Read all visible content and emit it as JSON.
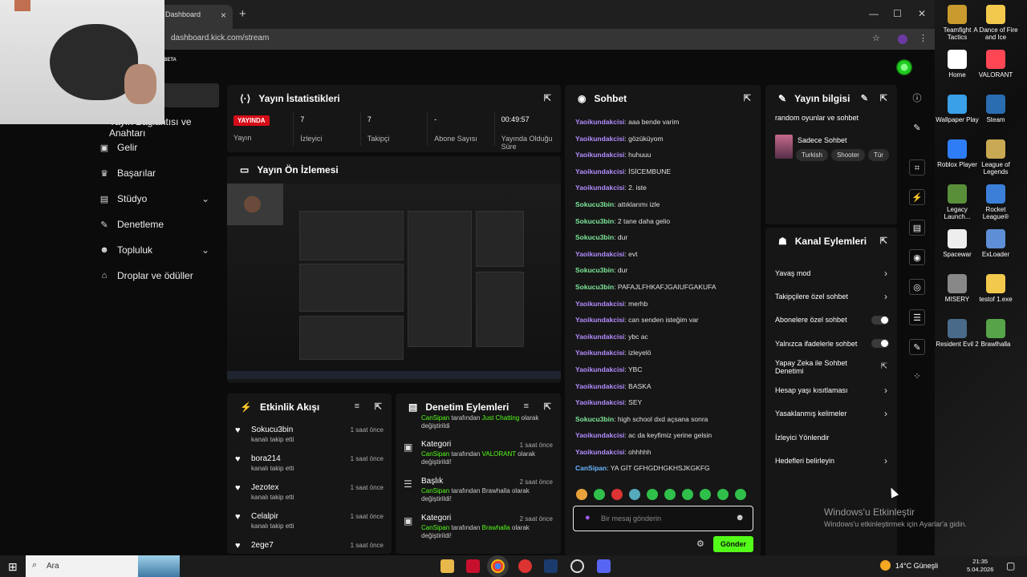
{
  "browser": {
    "tab_title": "Dashboard",
    "url": "dashboard.kick.com/stream",
    "beta_label": "BETA"
  },
  "sidebar": {
    "items": [
      {
        "label": "Yayın Bağlantısı ve Anahtarı",
        "icon": "key-icon"
      },
      {
        "label": "Gelir",
        "icon": "wallet-icon"
      },
      {
        "label": "Başarılar",
        "icon": "trophy-icon"
      },
      {
        "label": "Stüdyo",
        "icon": "studio-icon"
      },
      {
        "label": "Denetleme",
        "icon": "wrench-icon"
      },
      {
        "label": "Topluluk",
        "icon": "users-icon"
      },
      {
        "label": "Droplar ve ödüller",
        "icon": "gift-icon"
      }
    ]
  },
  "stats": {
    "title": "Yayın İstatistikleri",
    "live_badge": "YAYINDA",
    "items": [
      {
        "value": "",
        "label": "Yayın"
      },
      {
        "value": "7",
        "label": "İzleyici"
      },
      {
        "value": "7",
        "label": "Takipçi"
      },
      {
        "value": "-",
        "label": "Abone Sayısı"
      },
      {
        "value": "00:49:57",
        "label": "Yayında Olduğu Süre"
      }
    ]
  },
  "preview": {
    "title": "Yayın Ön İzlemesi"
  },
  "feed": {
    "title": "Etkinlik Akışı",
    "items": [
      {
        "name": "Sokucu3bin",
        "action": "kanalı takip etti",
        "time": "1 saat önce"
      },
      {
        "name": "bora214",
        "action": "kanalı takip etti",
        "time": "1 saat önce"
      },
      {
        "name": "Jezotex",
        "action": "kanalı takip etti",
        "time": "1 saat önce"
      },
      {
        "name": "Celalpir",
        "action": "kanalı takip etti",
        "time": "1 saat önce"
      },
      {
        "name": "2ege7",
        "action": "",
        "time": "1 saat önce"
      }
    ]
  },
  "mod": {
    "title": "Denetim Eylemleri",
    "top_partial": {
      "user": "CanSipan",
      "mid": " tarafından ",
      "value": "Just Chatting",
      "end": " olarak",
      "line2": "değiştirildi"
    },
    "items": [
      {
        "type": "Kategori",
        "time": "1 saat önce",
        "user": "CanSipan",
        "mid": " tarafından ",
        "value": "VALORANT",
        "end": " olarak",
        "line2": "değiştirildi!"
      },
      {
        "type": "Başlık",
        "time": "2 saat önce",
        "user": "CanSipan",
        "mid": " tarafından Brawhalla olarak",
        "value": "",
        "end": "",
        "line2": "değiştirildi!"
      },
      {
        "type": "Kategori",
        "time": "2 saat önce",
        "user": "CanSipan",
        "mid": " tarafından ",
        "value": "Brawhalla",
        "end": " olarak",
        "line2": "değiştirildi!"
      }
    ]
  },
  "chat": {
    "title": "Sohbet",
    "messages": [
      {
        "user": "Yaoikundakcisi",
        "text": ": aaa bende varim",
        "color": "#b48cff"
      },
      {
        "user": "Yaoikundakcisi",
        "text": ": gözüküyom",
        "color": "#b48cff"
      },
      {
        "user": "Yaoikundakcisi",
        "text": ": huhuuu",
        "color": "#b48cff"
      },
      {
        "user": "Yaoikundakcisi",
        "text": ": İSİCEMBUNE",
        "color": "#b48cff"
      },
      {
        "user": "Yaoikundakcisi",
        "text": ": 2. iste",
        "color": "#b48cff"
      },
      {
        "user": "Sokucu3bin",
        "text": ": attıklarımı izle",
        "color": "#7ee89a"
      },
      {
        "user": "Sokucu3bin",
        "text": ": 2 tane daha gelio",
        "color": "#7ee89a"
      },
      {
        "user": "Sokucu3bin",
        "text": ": dur",
        "color": "#7ee89a"
      },
      {
        "user": "Yaoikundakcisi",
        "text": ": evt",
        "color": "#b48cff"
      },
      {
        "user": "Sokucu3bin",
        "text": ": dur",
        "color": "#7ee89a"
      },
      {
        "user": "Sokucu3bin",
        "text": ": PAFAJLFHKAFJGAIUFGAKUFA",
        "color": "#7ee89a"
      },
      {
        "user": "Yaoikundakcisi",
        "text": ": merhb",
        "color": "#b48cff"
      },
      {
        "user": "Yaoikundakcisi",
        "text": ": can senden isteğim var",
        "color": "#b48cff"
      },
      {
        "user": "Yaoikundakcisi",
        "text": ": ybc ac",
        "color": "#b48cff"
      },
      {
        "user": "Yaoikundakcisi",
        "text": ": izleyelö",
        "color": "#b48cff"
      },
      {
        "user": "Yaoikundakcisi",
        "text": ": YBC",
        "color": "#b48cff"
      },
      {
        "user": "Yaoikundakcisi",
        "text": ": BASKA",
        "color": "#b48cff"
      },
      {
        "user": "Yaoikundakcisi",
        "text": ": SEY",
        "color": "#b48cff"
      },
      {
        "user": "Sokucu3bin",
        "text": ": high school dxd açsana sonra",
        "color": "#7ee89a"
      },
      {
        "user": "Yaoikundakcisi",
        "text": ": ac da keyfimiz yerine gelsin",
        "color": "#b48cff"
      },
      {
        "user": "Yaoikundakcisi",
        "text": ": ohhhhh",
        "color": "#b48cff"
      },
      {
        "user": "CanSipan",
        "text": ": YA GİT GFHGDHGKHSJKGKFG",
        "color": "#6bb7ff"
      }
    ],
    "placeholder": "Bir mesaj gönderin",
    "send_label": "Gönder"
  },
  "info": {
    "title": "Yayın bilgisi",
    "stream_title": "random oyunlar ve sohbet",
    "language_label": "Sadece Sohbet",
    "tags": [
      "Turkish",
      "Shooter",
      "Tür"
    ]
  },
  "actions": {
    "title": "Kanal Eylemleri",
    "items": [
      {
        "label": "Yavaş mod",
        "control": "arrow"
      },
      {
        "label": "Takipçilere özel sohbet",
        "control": "arrow"
      },
      {
        "label": "Abonelere özel sohbet",
        "control": "toggle"
      },
      {
        "label": "Yalnızca ifadelerle sohbet",
        "control": "toggle"
      },
      {
        "label": "Yapay Zeka ile Sohbet Denetimi",
        "control": "external"
      },
      {
        "label": "Hesap yaşı kısıtlaması",
        "control": "arrow"
      },
      {
        "label": "Yasaklanmış kelimeler",
        "control": "arrow"
      },
      {
        "label": "İzleyici Yönlendir",
        "control": "none"
      },
      {
        "label": "Hedefleri belirleyin",
        "control": "arrow"
      }
    ]
  },
  "desktop": {
    "icons": [
      {
        "label": "Teamfight Tactics",
        "color": "#c99a2e"
      },
      {
        "label": "A Dance of Fire and Ice",
        "color": "#f2c94c"
      },
      {
        "label": "Home",
        "color": "#ffffff"
      },
      {
        "label": "VALORANT",
        "color": "#ff4655"
      },
      {
        "label": "Wallpaper Play",
        "color": "#3aa0e8"
      },
      {
        "label": "Steam",
        "color": "#2a6cb0"
      },
      {
        "label": "Roblox Player",
        "color": "#2f7df6"
      },
      {
        "label": "League of Legends",
        "color": "#c8a852"
      },
      {
        "label": "Legacy Launch...",
        "color": "#5a8f3a"
      },
      {
        "label": "Rocket League®",
        "color": "#3b7fd8"
      },
      {
        "label": "Spacewar",
        "color": "#eeeeee"
      },
      {
        "label": "ExLoader",
        "color": "#5e8fd6"
      },
      {
        "label": "MISERY",
        "color": "#888888"
      },
      {
        "label": "testof 1.exe",
        "color": "#f2c94c"
      },
      {
        "label": "Resident Evil 2",
        "color": "#4a6a8a"
      },
      {
        "label": "Brawlhalla",
        "color": "#56a34a"
      }
    ],
    "watermark_title": "Windows'u Etkinleştir",
    "watermark_sub": "Windows'u etkinleştirmek için Ayarlar'a gidin."
  },
  "taskbar": {
    "search_placeholder": "Ara",
    "weather": "14°C  Güneşli",
    "time": "21:35",
    "date": "5.04.2026"
  }
}
